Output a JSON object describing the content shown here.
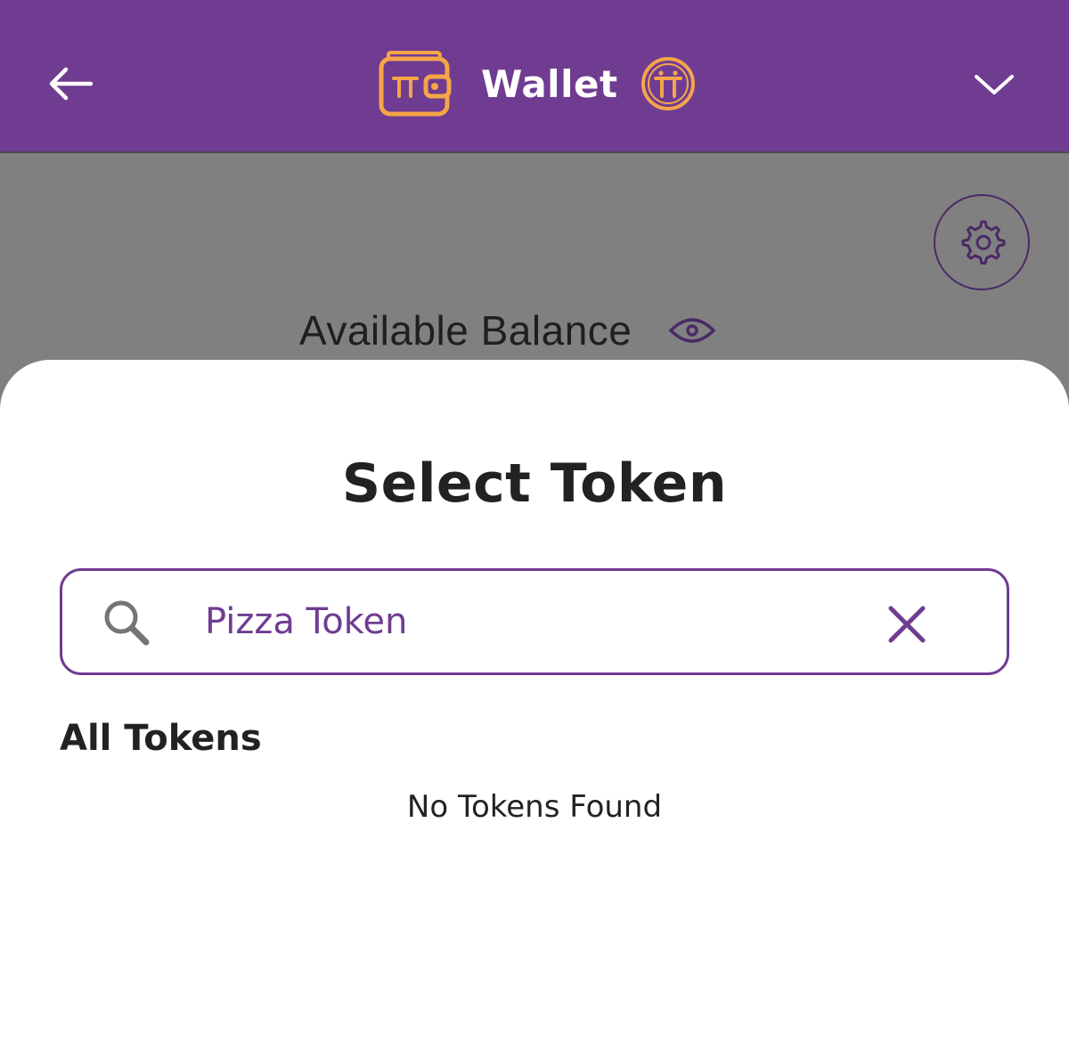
{
  "header": {
    "title": "Wallet",
    "back_icon": "arrow-left-icon",
    "wallet_icon": "wallet-icon",
    "pi_icon": "pi-coin-icon",
    "menu_icon": "chevron-down-icon"
  },
  "wallet": {
    "balance_label": "Available Balance",
    "settings_icon": "gear-icon",
    "visibility_icon": "eye-icon"
  },
  "sheet": {
    "title": "Select Token",
    "search": {
      "value": "Pizza Token",
      "icon": "search-icon",
      "clear_icon": "close-icon"
    },
    "section_title": "All Tokens",
    "empty_message": "No Tokens Found"
  },
  "colors": {
    "brand_purple": "#6f3c91",
    "accent_orange": "#f5a547",
    "overlay_gray": "#808080"
  }
}
